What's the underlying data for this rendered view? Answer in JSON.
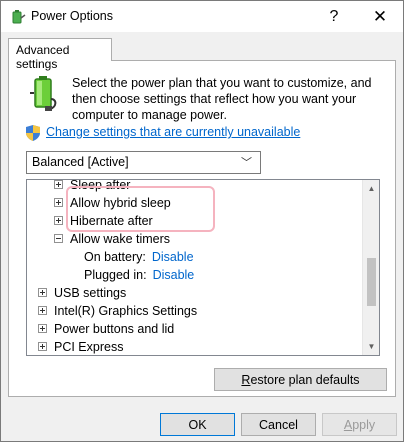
{
  "window": {
    "title": "Power Options",
    "help_glyph": "?",
    "close_glyph": "✕"
  },
  "tab": {
    "label": "Advanced settings"
  },
  "intro": {
    "text": "Select the power plan that you want to customize, and then choose settings that reflect how you want your computer to manage power."
  },
  "change_link": {
    "label": "Change settings that are currently unavailable"
  },
  "plan_select": {
    "value": "Balanced [Active]",
    "chevron": "﹀"
  },
  "tree": {
    "items": [
      {
        "label": "Sleep after",
        "expander": "plus"
      },
      {
        "label": "Allow hybrid sleep",
        "expander": "plus"
      },
      {
        "label": "Hibernate after",
        "expander": "plus"
      },
      {
        "label": "Allow wake timers",
        "expander": "minus"
      },
      {
        "label": "On battery:",
        "value": "Disable"
      },
      {
        "label": "Plugged in:",
        "value": "Disable"
      },
      {
        "label": "USB settings",
        "expander": "plus"
      },
      {
        "label": "Intel(R) Graphics Settings",
        "expander": "plus"
      },
      {
        "label": "Power buttons and lid",
        "expander": "plus"
      },
      {
        "label": "PCI Express",
        "expander": "plus"
      }
    ]
  },
  "restore_button": {
    "mnemonic": "R",
    "rest": "estore plan defaults"
  },
  "footer": {
    "ok": "OK",
    "cancel": "Cancel",
    "apply_mnemonic": "A",
    "apply_rest": "pply"
  },
  "icons": {
    "title": "power-options-icon",
    "battery": "battery-plug-icon",
    "shield": "uac-shield-icon"
  }
}
